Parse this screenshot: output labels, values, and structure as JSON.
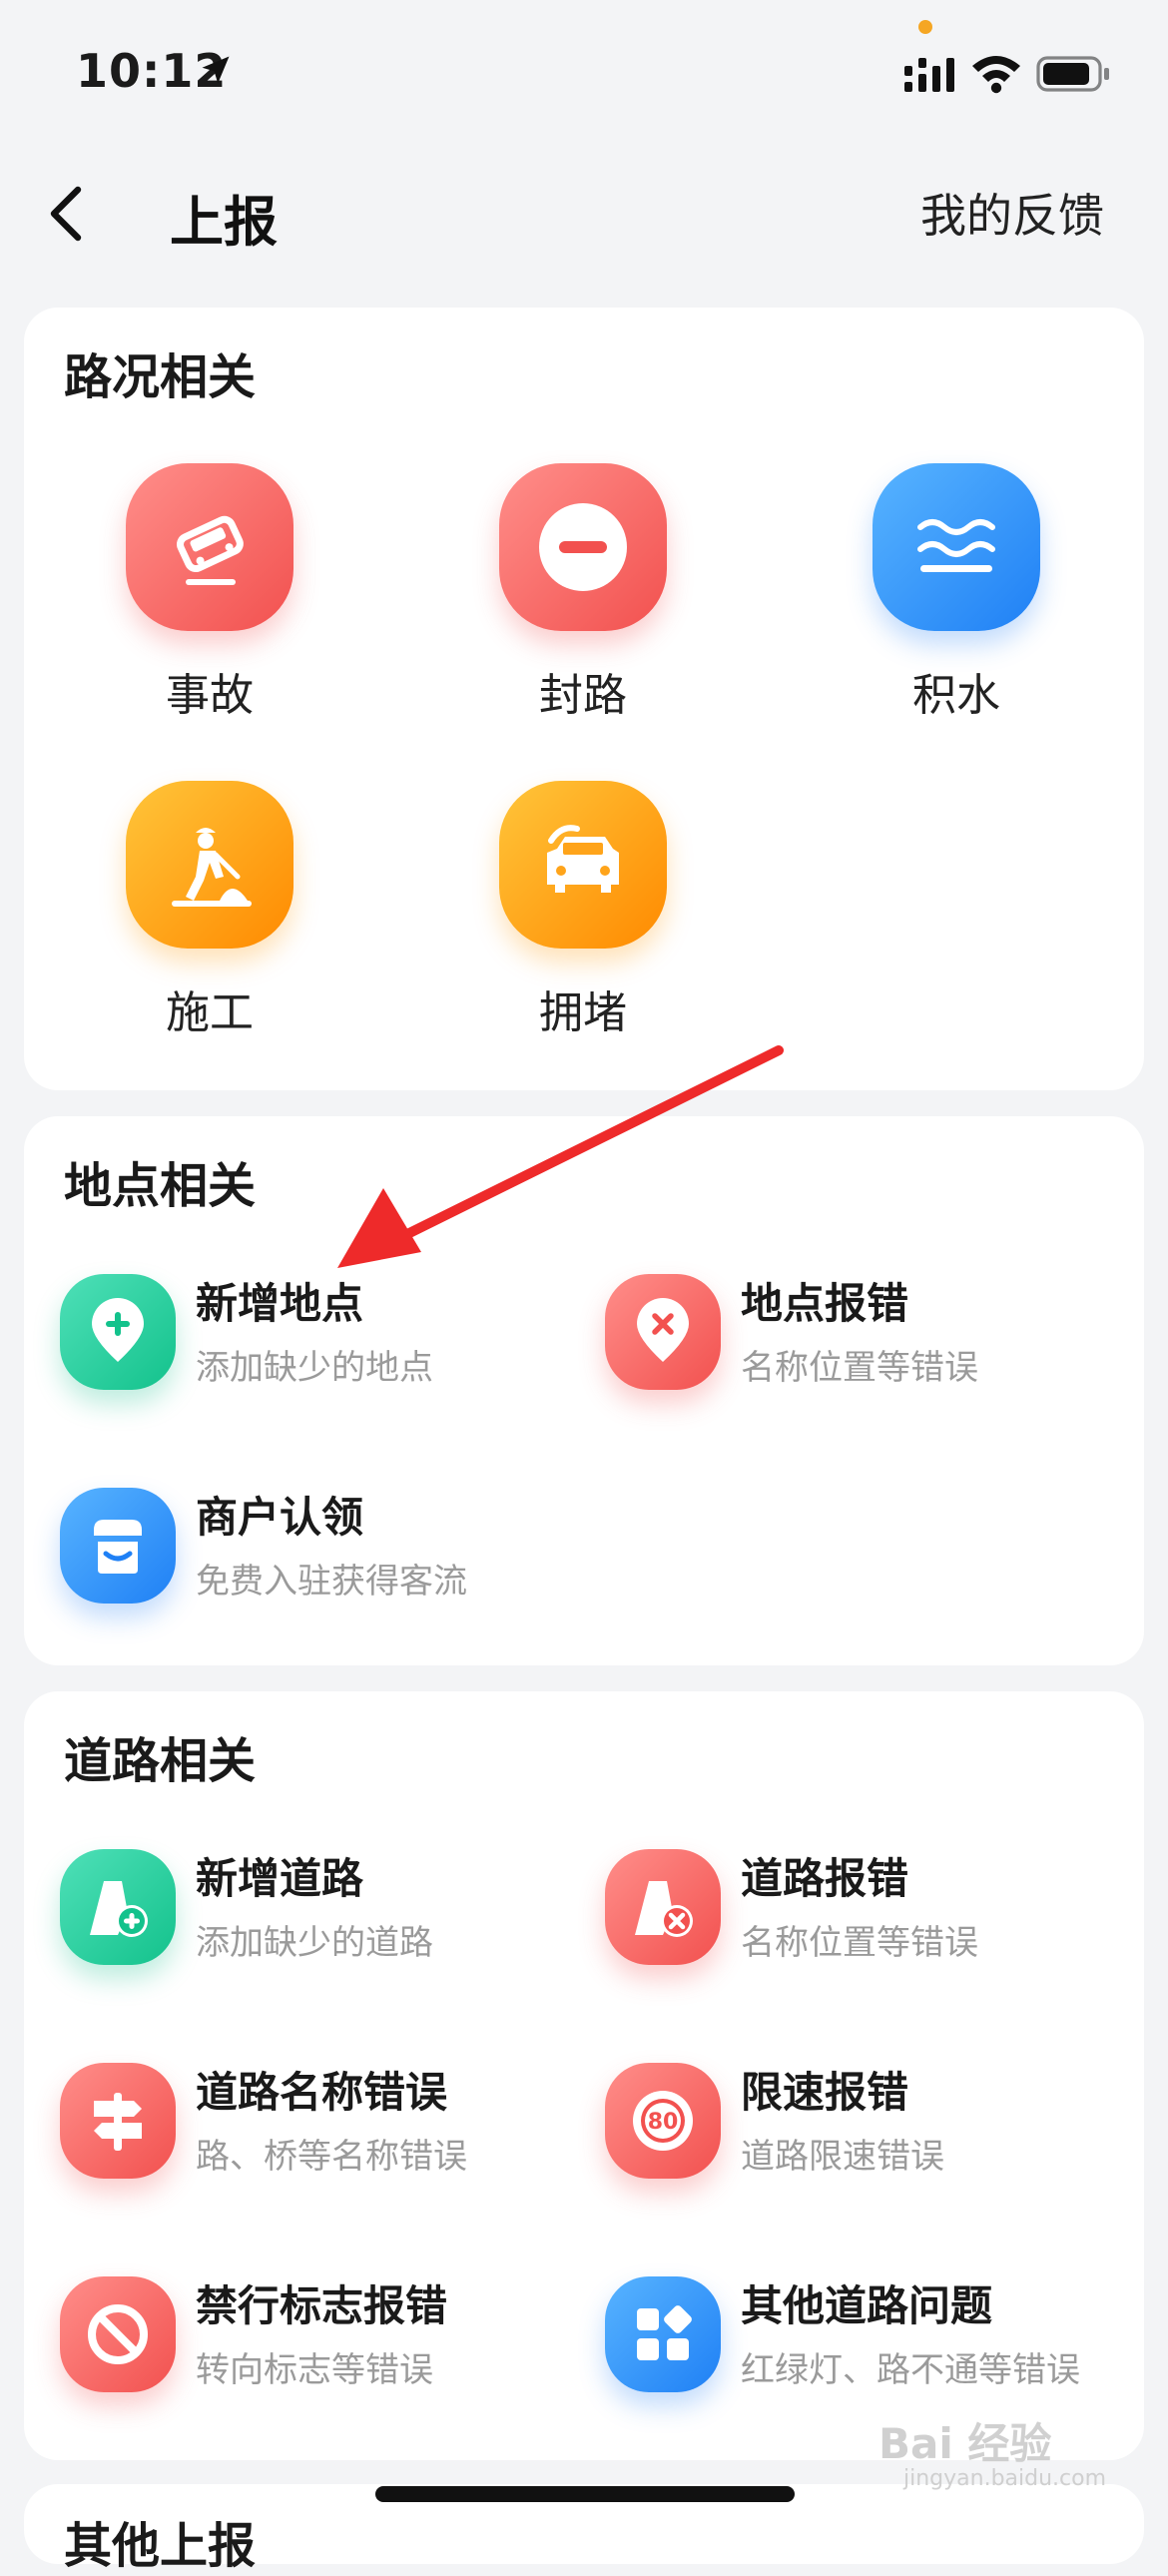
{
  "status_bar": {
    "time": "10:12"
  },
  "nav": {
    "title": "上报",
    "right_link": "我的反馈"
  },
  "road_conditions": {
    "title": "路况相关",
    "items": [
      {
        "label": "事故",
        "icon": "car-accident-icon",
        "color": "#f2514f"
      },
      {
        "label": "封路",
        "icon": "no-entry-icon",
        "color": "#f2514f"
      },
      {
        "label": "积水",
        "icon": "water-waves-icon",
        "color": "#1f80f5"
      },
      {
        "label": "施工",
        "icon": "construction-worker-icon",
        "color": "#ff8a00"
      },
      {
        "label": "拥堵",
        "icon": "traffic-jam-icon",
        "color": "#ff8a00"
      }
    ]
  },
  "place": {
    "title": "地点相关",
    "items": [
      {
        "title": "新增地点",
        "subtitle": "添加缺少的地点",
        "icon": "add-location-icon"
      },
      {
        "title": "地点报错",
        "subtitle": "名称位置等错误",
        "icon": "location-error-icon"
      },
      {
        "title": "商户认领",
        "subtitle": "免费入驻获得客流",
        "icon": "shop-icon"
      }
    ]
  },
  "road": {
    "title": "道路相关",
    "items": [
      {
        "title": "新增道路",
        "subtitle": "添加缺少的道路",
        "icon": "add-road-icon"
      },
      {
        "title": "道路报错",
        "subtitle": "名称位置等错误",
        "icon": "road-error-icon"
      },
      {
        "title": "道路名称错误",
        "subtitle": "路、桥等名称错误",
        "icon": "signpost-icon"
      },
      {
        "title": "限速报错",
        "subtitle": "道路限速错误",
        "icon": "speed-limit-icon"
      },
      {
        "title": "禁行标志报错",
        "subtitle": "转向标志等错误",
        "icon": "prohibited-icon"
      },
      {
        "title": "其他道路问题",
        "subtitle": "红绿灯、路不通等错误",
        "icon": "grid-apps-icon"
      }
    ]
  },
  "next_section": {
    "title": "其他上报"
  },
  "watermark": {
    "text": "Bai 经验",
    "sub": "jingyan.baidu.com"
  }
}
